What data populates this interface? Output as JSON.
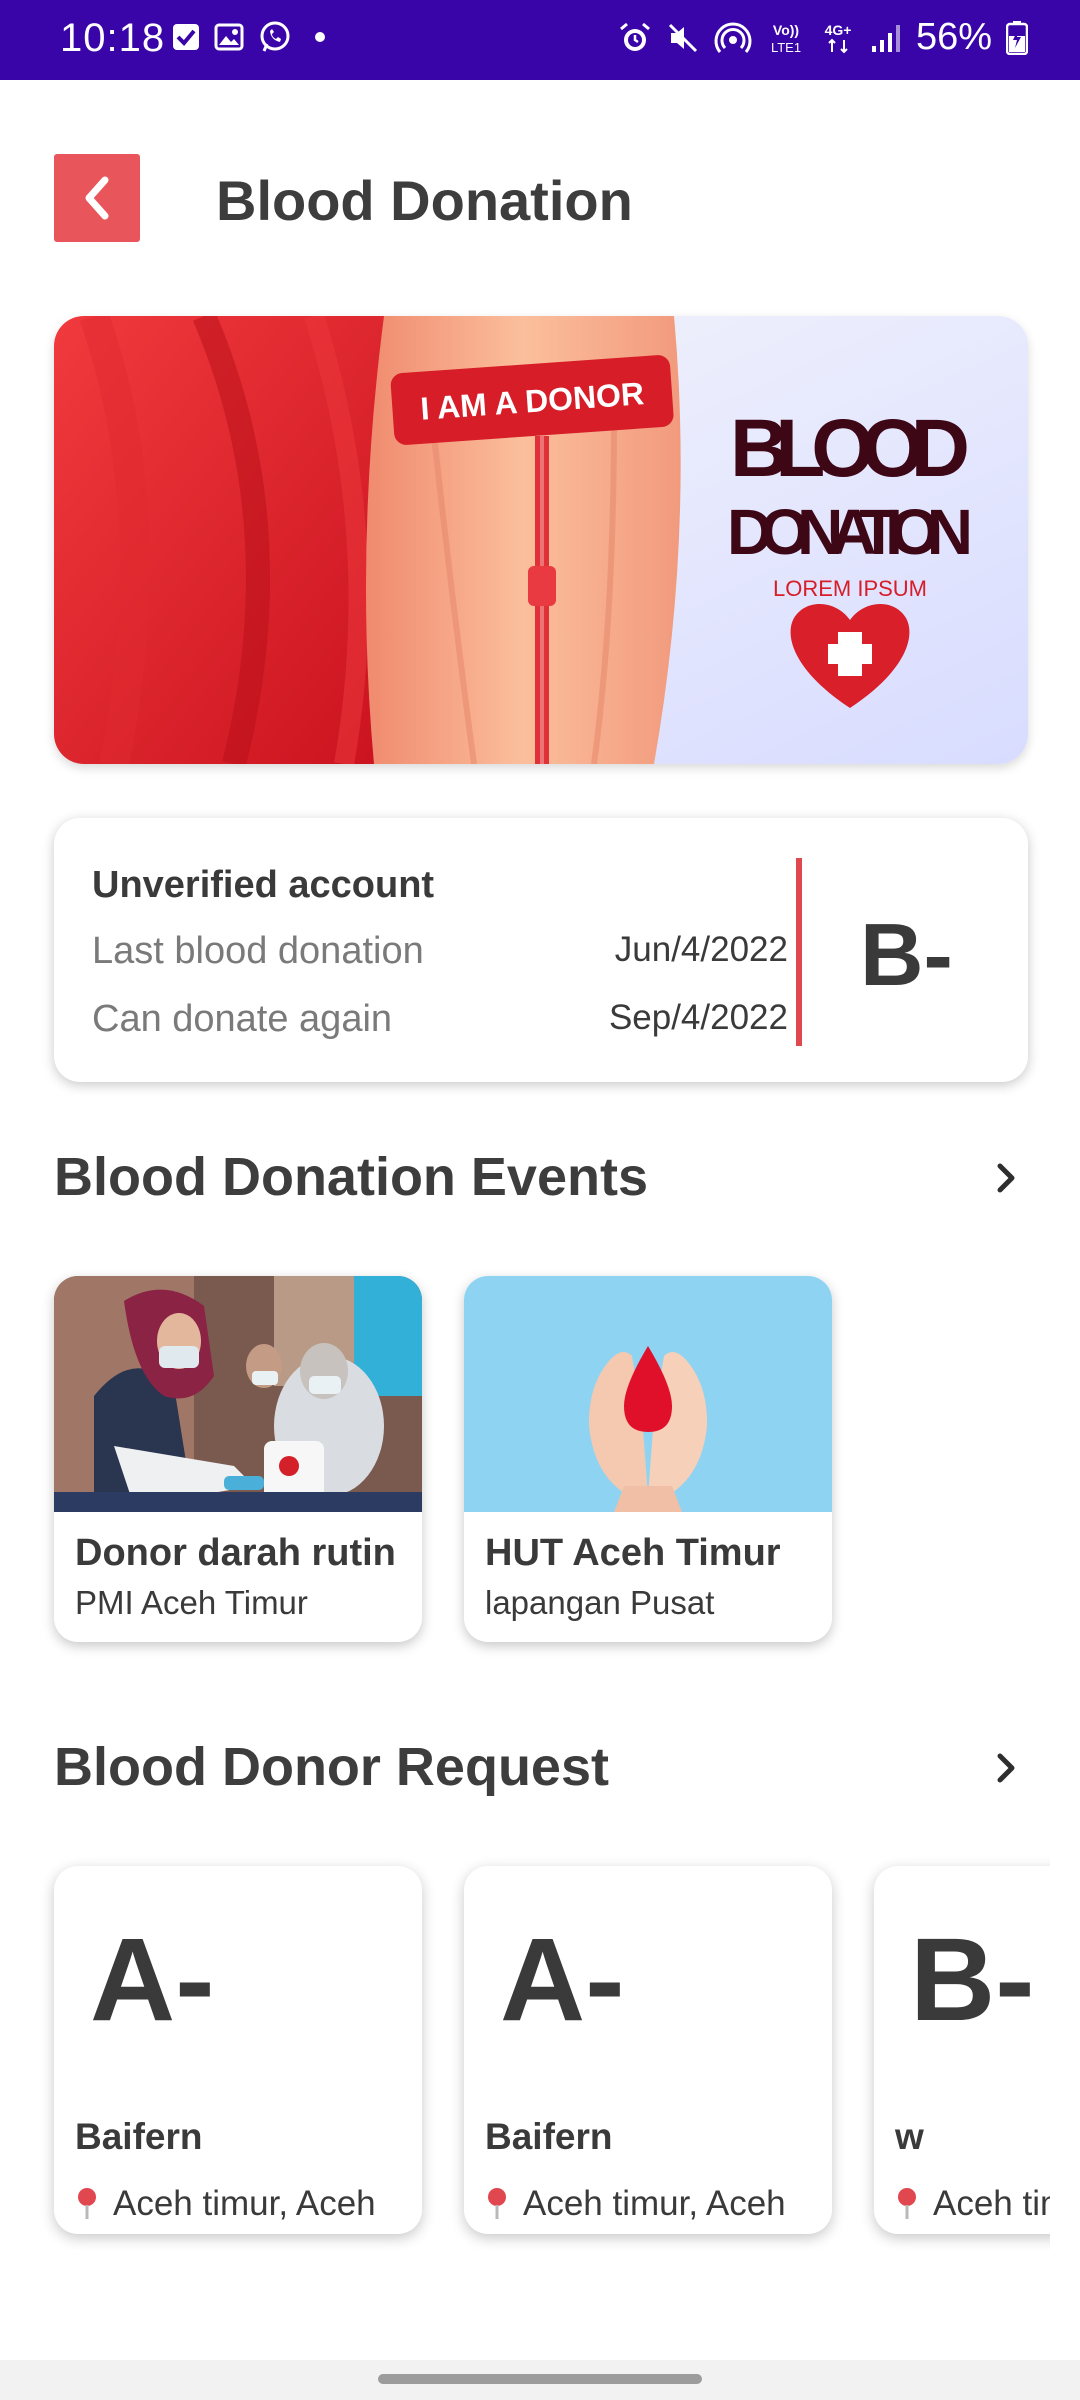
{
  "status_bar": {
    "time": "10:18",
    "battery": "56%",
    "left_icons": [
      "checkbox-notification-icon",
      "gallery-notification-icon",
      "whatsapp-icon",
      "dot-icon"
    ],
    "right_icons": [
      "alarm-icon",
      "mute-icon",
      "hotspot-icon",
      "volte-icon",
      "4g-icon",
      "signal-icon",
      "battery-icon"
    ],
    "volte_text": "Vo)) LTE1",
    "network_text": "4G+",
    "background_color": "#3a05a8"
  },
  "header": {
    "title": "Blood Donation",
    "back_icon": "chevron-left-icon",
    "accent_color": "#e8565c"
  },
  "banner": {
    "ribbon_text": "I AM A DONOR",
    "headline_line1": "BLOOD",
    "headline_line2": "DONATION",
    "tagline": "LOREM IPSUM"
  },
  "account_card": {
    "status": "Unverified account",
    "last_donation_label": "Last blood donation",
    "last_donation_value": "Jun/4/2022",
    "next_donation_label": "Can donate again",
    "next_donation_value": "Sep/4/2022",
    "blood_type": "B-"
  },
  "events": {
    "title": "Blood Donation Events",
    "items": [
      {
        "title": "Donor darah rutin",
        "subtitle": "PMI Aceh Timur",
        "image": "volunteer-photo"
      },
      {
        "title": "HUT Aceh Timur",
        "subtitle": "lapangan Pusat",
        "image": "hands-blood-drop"
      }
    ]
  },
  "requests": {
    "title": "Blood Donor Request",
    "items": [
      {
        "blood_type": "A-",
        "name": "Baifern",
        "location": "Aceh timur, Aceh"
      },
      {
        "blood_type": "A-",
        "name": "Baifern",
        "location": "Aceh timur, Aceh"
      },
      {
        "blood_type": "B-",
        "name": "w",
        "location": "Aceh timur, Aceh"
      }
    ]
  }
}
